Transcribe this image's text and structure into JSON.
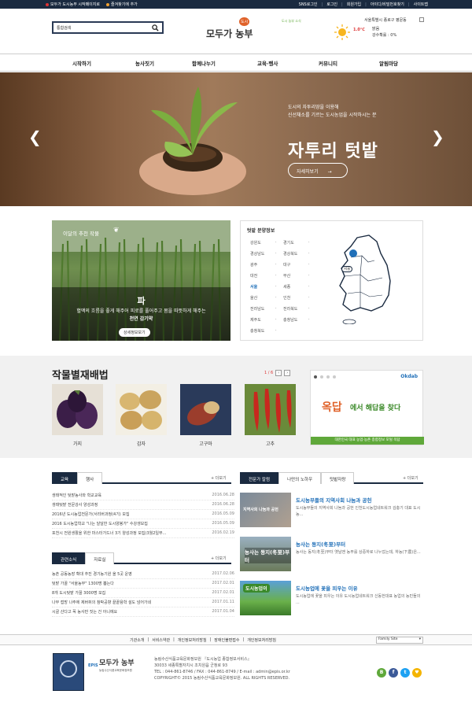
{
  "topbar": {
    "left": [
      "모두가 도시농부 시작페이지로",
      "즐겨찾기에 추가"
    ],
    "right": [
      "SNS로그인",
      "로그인",
      "회원가입",
      "아이디/비밀번호찾기",
      "사이트맵"
    ]
  },
  "search": {
    "placeholder": "통합검색"
  },
  "logo": {
    "main": "모두가 농부",
    "badge": "도시",
    "tagline": "도시 농부 소식"
  },
  "weather": {
    "location": "서울특별시 종로구 평문동",
    "temp": "1.0℃",
    "condition": "맑음",
    "rain": "강수확률 : 0%"
  },
  "nav": [
    "시작하기",
    "농사짓기",
    "함께나누기",
    "교육·행사",
    "커뮤니티",
    "알림마당"
  ],
  "hero": {
    "sub1": "도시의 자투리땅을 이용해",
    "sub2": "신선채소를 기르는 도시농업을 시작하시는 분",
    "title": "자투리 텃밭",
    "button": "자세히보기"
  },
  "season": {
    "tag": "이달의 추천 작물",
    "name": "파",
    "desc1": "혈액의 흐름을 좋게 해주어 피로를 풀어주고 몸을 따뜻하게 해주는",
    "desc2": "천연 감기약",
    "more": "상세정보보기"
  },
  "garden": {
    "title": "텃밭 분양정보",
    "regions": [
      "강원도",
      "경기도",
      "경상남도",
      "경상북도",
      "광주",
      "대구",
      "대전",
      "부산",
      "서울",
      "세종",
      "울산",
      "인천",
      "전라남도",
      "전라북도",
      "제주도",
      "충청남도",
      "충청북도"
    ],
    "selected": "서울",
    "map_label": "서울"
  },
  "crops": {
    "title": "작물별재배법",
    "pager": "1 / 6",
    "items": [
      "가지",
      "감자",
      "고구마",
      "고추"
    ]
  },
  "banner": {
    "brand": "Okdab",
    "text1": "옥답",
    "text2": "에서 해답을 찾다",
    "caption": "대한민국 대표 농업·농촌 종합정보 포털 옥답"
  },
  "edu": {
    "tabs": [
      "교육",
      "행사"
    ],
    "more": "+ 더보기",
    "items": [
      {
        "t": "생태적인 텃밭농사와 학교교육",
        "d": "2016.06.28"
      },
      {
        "t": "생태텃밭 전문강사 양성과정",
        "d": "2016.06.28"
      },
      {
        "t": "2016년 도시농업전문가(서리버과정(4기) 모집",
        "d": "2016.05.09"
      },
      {
        "t": "2016 도시농업학교 \"나는 달달한 도시양봉가\" 수강생모집",
        "d": "2016.05.09"
      },
      {
        "t": "포천시 전원생활을 위한 마스터가드너 3기 양성과정 모집(3월2일부...",
        "d": "2016.02.19"
      }
    ]
  },
  "news": {
    "tabs": [
      "관련소식",
      "자료실"
    ],
    "more": "+ 더보기",
    "items": [
      {
        "t": "농촌 공동농장 확대 추진 경기농기원 올 5곳 운영",
        "d": "2017.02.06"
      },
      {
        "t": "텃밭 가꿀 \"서울농부\" 1300명 뽑는다",
        "d": "2017.02.01"
      },
      {
        "t": "8개 도시텃밭 가꿀 3000명 모집",
        "d": "2017.02.01"
      },
      {
        "t": "나무 접방 나주에 제버쥐의 참박공향 끝끝용학 설도 넘어가네",
        "d": "2017.01.11"
      },
      {
        "t": "시골 산다고 꼭 농사만 짓는 건 아니에요",
        "d": "2017.01.04"
      }
    ]
  },
  "expert": {
    "tabs": [
      "전문가 칼럼",
      "나만의 노하우",
      "텃밭자랑"
    ],
    "more": "+ 더보기",
    "cards": [
      {
        "title": "도시농부들의 지역사회 나눔과 공헌",
        "desc": "도시농부들의 지역사회 나눔과 공헌 인천도시농업네트워크 김충기 대표 도시농...",
        "thumb": "지역사회 나눔과 공헌"
      },
      {
        "title": "농사는 동지(冬至)부터",
        "desc": "농사는 동지(冬至)부터 옛날엔 농부를 상중하로 나누었는데, 하농(下農)은...",
        "thumb": "농사는 동지(冬至)부터"
      },
      {
        "title": "도시농업에 꽃을 피우는 이유",
        "desc": "도시농업에 꽃을 피우는 이유 도시농업네트워크 신동헌대표 농업의 농민들의 ...",
        "thumb": "도시농업이"
      }
    ]
  },
  "footer": {
    "links": [
      "기관소개",
      "서비스약관",
      "개인정보처리방침",
      "장애인불편접수",
      "개인정보처리방침"
    ],
    "family": "Family Site",
    "org": "농림수산식품교육문화정보원",
    "info1": "농림수산식품교육문화정보원 『도시농업 종합정보서비스』",
    "info2": "30033 세종특별자치시 조치원읍 군청로 93",
    "info3": "TEL : 044-861-8746 / FAX : 044-861-8749 / E-mail : admin@epis.or.kr",
    "info4": "COPYRIGHT© 2015 농림수산식품교육문화정보원. ALL RIGHTS RESERVED.",
    "sns": [
      "B",
      "f",
      "t",
      "♥"
    ]
  },
  "colors": {
    "navy": "#1a2a40",
    "green": "#5fa83a",
    "blue": "#1f6fb8"
  }
}
